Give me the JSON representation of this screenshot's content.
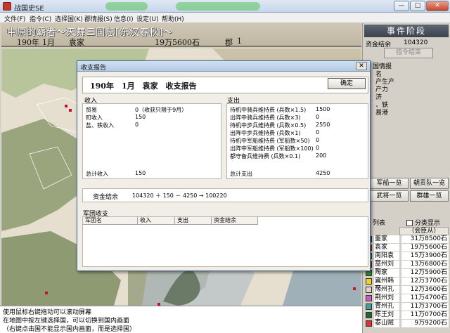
{
  "window": {
    "title": "战国史SE",
    "min_label": "—",
    "max_label": "□",
    "close_label": "✕"
  },
  "menu": [
    "文件(F)",
    "指令(C)",
    "选择国(K)",
    "郡情报(S)",
    "信息(I)",
    "设定(U)",
    "帮助(H)"
  ],
  "header": {
    "title": "中原的霸者～天舞三国志[东汉春秋]～",
    "year": "190年",
    "month": "1月",
    "ruler": "袁家",
    "rice": "19万5600石",
    "district_label": "郡",
    "district_count": "1"
  },
  "phase": {
    "title": "事件阶段",
    "funds_label": "资金结余",
    "funds_value": "104320",
    "end_button": "指令结束"
  },
  "info": {
    "title": "国情报",
    "items": [
      "名",
      "产生产",
      "产力",
      "济",
      "、铁",
      "易港"
    ]
  },
  "list_buttons": [
    "军船一览",
    "朝贡队一览",
    "武将一览",
    "群雄一览"
  ],
  "faction_list": {
    "title": "列表",
    "sub_display": "分类显示",
    "leader_header": "（会臣从）",
    "rows": [
      {
        "name": "董家",
        "value": "31万8500石",
        "color": "#1f3f8f"
      },
      {
        "name": "袁家",
        "value": "19万5600石",
        "color": "#d81b1b"
      },
      {
        "name": "南阳袁家",
        "value": "15万3900石",
        "color": "#6aa0d8"
      },
      {
        "name": "益州刘家",
        "value": "13万6800石",
        "color": "#7a4a9a"
      },
      {
        "name": "陶家",
        "value": "12万5900石",
        "color": "#2e8b3a"
      },
      {
        "name": "冀州韩家",
        "value": "12万3700石",
        "color": "#f0d020"
      },
      {
        "name": "豫州孔家",
        "value": "12万3600石",
        "color": "#e0d8c0"
      },
      {
        "name": "荆州刘家",
        "value": "11万4700石",
        "color": "#c060c0"
      },
      {
        "name": "青州孔家",
        "value": "11万3700石",
        "color": "#40a0a0"
      },
      {
        "name": "陈王刘家",
        "value": "11万0700石",
        "color": "#1a6a30"
      },
      {
        "name": "泰山贼",
        "value": "9万9200石",
        "color": "#e03030"
      }
    ]
  },
  "status": [
    "使用鼠标右键拖动可以滚动屏幕",
    "在地图中按左键选择国，可以切换到国内画面",
    "（右键点击国不能显示国内画面，而是选择国）"
  ],
  "dialog": {
    "title": "收支报告",
    "close_label": "✕",
    "report_title": "190年　1月　袁家　收支报告",
    "ok_label": "确定",
    "income": {
      "label": "收入",
      "rows": [
        {
          "label": "贸易",
          "value": "0（收获只限于9月）"
        },
        {
          "label": "町收入",
          "value": "150"
        },
        {
          "label": "盐、铁收入",
          "value": "0"
        }
      ],
      "total_label": "总计收入",
      "total_value": "150"
    },
    "expense": {
      "label": "支出",
      "rows": [
        {
          "label": "待机中骑兵维持费 (兵数×1.5)",
          "value": "1500"
        },
        {
          "label": "出阵中骑兵维持费 (兵数×3)",
          "value": "0"
        },
        {
          "label": "待机中步兵维持费 (兵数×0.5)",
          "value": "2550"
        },
        {
          "label": "出阵中步兵维持费 (兵数×1)",
          "value": "0"
        },
        {
          "label": "待机中军船维持费 (军船数×50)",
          "value": "0"
        },
        {
          "label": "出阵中军船维持费 (军船数×100)",
          "value": "0"
        },
        {
          "label": "都守备兵维持费 (兵数×0.1)",
          "value": "200"
        }
      ],
      "total_label": "总计支出",
      "total_value": "4250"
    },
    "funds": {
      "label": "资金结余",
      "equation": "104320 ＋ 150 － 4250 → 100220"
    },
    "corps": {
      "label": "军团收支",
      "columns": [
        "军团名",
        "收入",
        "支出",
        "资金结余"
      ]
    }
  }
}
